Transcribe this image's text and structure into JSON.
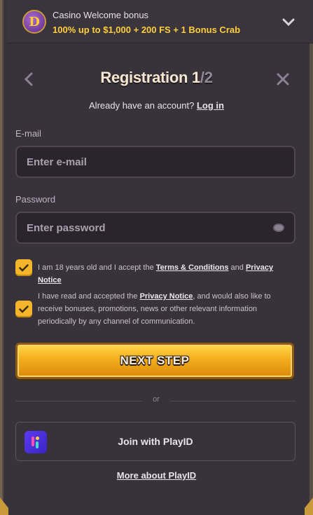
{
  "bonus": {
    "logo_letter": "D",
    "title": "Casino Welcome bonus",
    "description": "100% up to $1,000 + 200 FS + 1 Bonus Crab"
  },
  "header": {
    "title_main": "Registration 1",
    "title_sep": "/",
    "title_total": "2",
    "have_account": "Already have an account?",
    "login_link": "Log in"
  },
  "form": {
    "email_label": "E-mail",
    "email_placeholder": "Enter e-mail",
    "password_label": "Password",
    "password_placeholder": "Enter password"
  },
  "consent": {
    "age_prefix": "I am 18 years old and I accept the",
    "terms_link": "Terms & Conditions",
    "and": "and",
    "privacy_link": "Privacy Notice",
    "marketing_prefix": "I have read and accepted the",
    "marketing_privacy_link": "Privacy Notice",
    "marketing_suffix": ", and would also like to receive bonuses, promotions, news or other relevant information periodically by any channel of communication."
  },
  "actions": {
    "next_step": "NEXT STEP",
    "or": "or",
    "playid": "Join with PlayID",
    "more_playid": "More about PlayID"
  },
  "colors": {
    "accent": "#f4b52a",
    "bonus_text": "#ffcf3a",
    "background": "#38323b"
  },
  "icons": {
    "back": "chevron-left-icon",
    "close": "close-icon",
    "expand": "chevron-down-icon",
    "password_toggle": "eye-icon",
    "check": "checkmark-icon",
    "playid": "playid-logo-icon"
  }
}
